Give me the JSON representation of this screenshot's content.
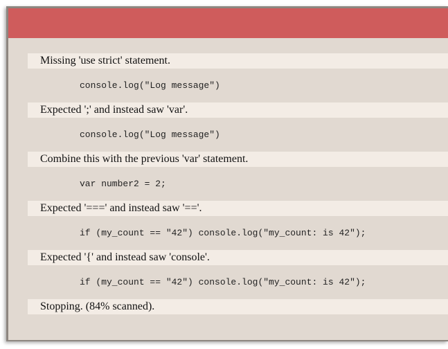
{
  "report": {
    "errors": [
      {
        "message": "Missing 'use strict' statement.",
        "code": "console.log(\"Log message\")"
      },
      {
        "message": "Expected ';' and instead saw 'var'.",
        "code": "console.log(\"Log message\")"
      },
      {
        "message": "Combine this with the previous 'var' statement.",
        "code": "var number2 = 2;"
      },
      {
        "message": "Expected '===' and instead saw '=='.",
        "code": "if (my_count == \"42\") console.log(\"my_count: is 42\");"
      },
      {
        "message": "Expected '{' and instead saw 'console'.",
        "code": "if (my_count == \"42\") console.log(\"my_count: is 42\");"
      }
    ],
    "footer": "Stopping. (84% scanned)."
  },
  "colors": {
    "header_bar": "#cf5c5c",
    "panel_background": "#e1d9d1",
    "message_row": "#f3ece5"
  }
}
